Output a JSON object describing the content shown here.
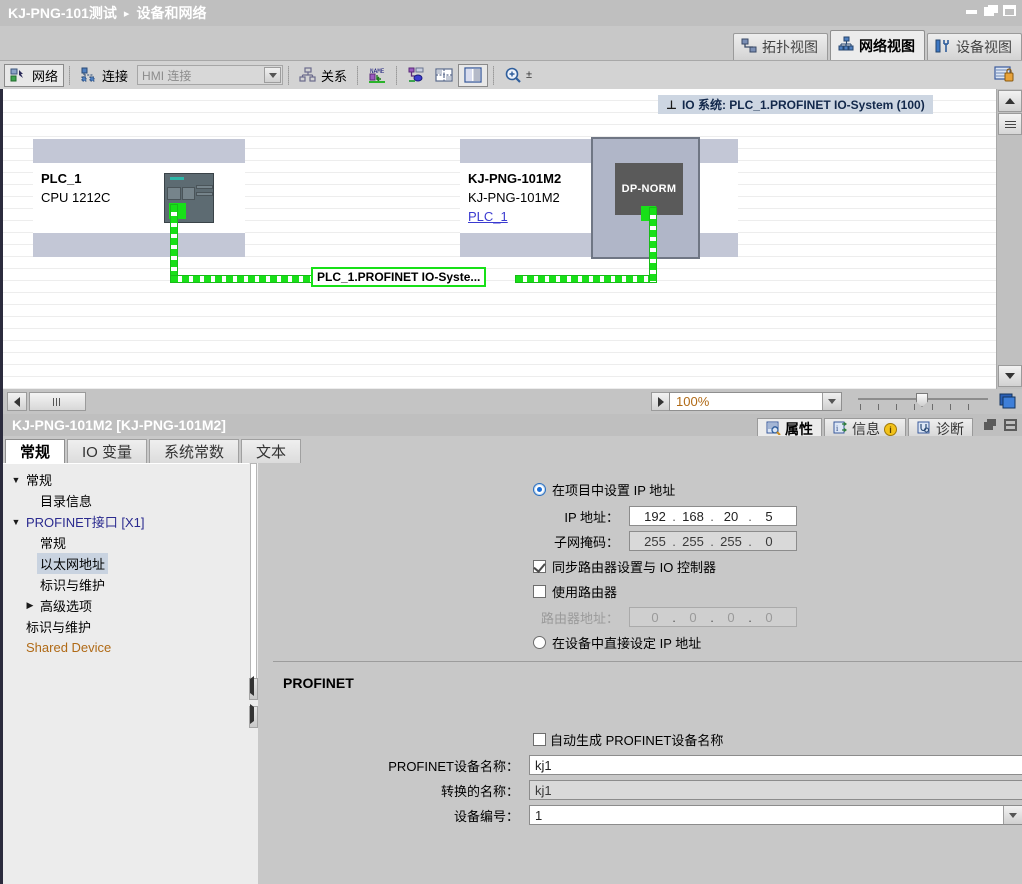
{
  "titlebar": {
    "breadcrumb": [
      "KJ-PNG-101测试",
      "设备和网络"
    ],
    "separator": "▸",
    "minimize": "minimize",
    "restore": "restore",
    "maximize": "maximize"
  },
  "view_tabs": [
    {
      "label": "拓扑视图",
      "icon": "topology-icon",
      "active": false
    },
    {
      "label": "网络视图",
      "icon": "network-icon",
      "active": true
    },
    {
      "label": "设备视图",
      "icon": "device-icon",
      "active": false
    }
  ],
  "toolbar": {
    "network_label": "网络",
    "connection_label": "连接",
    "connection_combo_value": "HMI 连接",
    "relation_label": "关系",
    "icons": [
      "name-overlay-icon",
      "address-overlay-icon",
      "page-break-icon",
      "columns-icon",
      "zoom-icon"
    ]
  },
  "canvas": {
    "io_system_badge": "IO 系统: PLC_1.PROFINET IO-System (100)",
    "io_system_pin": "⊥",
    "devices": [
      {
        "name": "PLC_1",
        "type": "CPU 1212C",
        "link": null,
        "module_label": null
      },
      {
        "name": "KJ-PNG-101M2",
        "type": "KJ-PNG-101M2",
        "link": "PLC_1",
        "module_label": "DP-NORM"
      }
    ],
    "connection_label": "PLC_1.PROFINET IO-Syste...",
    "link_color": "#18e018"
  },
  "statusbar": {
    "zoom_value": "100%",
    "scroll_left": "◀",
    "scroll_right": "▶"
  },
  "inspector": {
    "title": "KJ-PNG-101M2 [KJ-PNG-101M2]",
    "tabs": [
      {
        "label": "属性",
        "icon": "properties-icon",
        "active": true
      },
      {
        "label": "信息",
        "icon": "info-icon",
        "badge": "i",
        "active": false
      },
      {
        "label": "诊断",
        "icon": "diagnostics-icon",
        "active": false
      }
    ],
    "property_tabs": [
      {
        "label": "常规",
        "active": true
      },
      {
        "label": "IO 变量",
        "active": false
      },
      {
        "label": "系统常数",
        "active": false
      },
      {
        "label": "文本",
        "active": false
      }
    ],
    "nav_items": [
      {
        "label": "常规",
        "indent": 0,
        "tri": "▼",
        "selected": false,
        "style": "normal"
      },
      {
        "label": "目录信息",
        "indent": 1,
        "tri": "",
        "selected": false,
        "style": "normal"
      },
      {
        "label": "PROFINET接口 [X1]",
        "indent": 0,
        "tri": "▼",
        "selected": false,
        "style": "blue"
      },
      {
        "label": "常规",
        "indent": 1,
        "tri": "",
        "selected": false,
        "style": "normal"
      },
      {
        "label": "以太网地址",
        "indent": 1,
        "tri": "",
        "selected": true,
        "style": "normal"
      },
      {
        "label": "标识与维护",
        "indent": 1,
        "tri": "",
        "selected": false,
        "style": "normal"
      },
      {
        "label": "高级选项",
        "indent": 1,
        "tri": "▶",
        "selected": false,
        "style": "normal"
      },
      {
        "label": "标识与维护",
        "indent": 0,
        "tri": "",
        "selected": false,
        "style": "normal"
      },
      {
        "label": "Shared Device",
        "indent": 0,
        "tri": "",
        "selected": false,
        "style": "orange"
      }
    ],
    "ip_section": {
      "set_in_project_label": "在项目中设置 IP 地址",
      "set_in_project_selected": true,
      "ip_label": "IP 地址：",
      "ip_octets": [
        "192",
        "168",
        "20",
        "5"
      ],
      "subnet_label": "子网掩码：",
      "subnet_octets": [
        "255",
        "255",
        "255",
        "0"
      ],
      "sync_router_label": "同步路由器设置与 IO 控制器",
      "sync_router_checked": true,
      "use_router_label": "使用路由器",
      "use_router_checked": false,
      "router_addr_label": "路由器地址：",
      "router_octets": [
        "0",
        "0",
        "0",
        "0"
      ],
      "set_in_device_label": "在设备中直接设定 IP 地址",
      "set_in_device_selected": false
    },
    "profinet_section": {
      "title": "PROFINET",
      "auto_generate_label": "自动生成 PROFINET设备名称",
      "auto_generate_checked": false,
      "device_name_label": "PROFINET设备名称：",
      "device_name_value": "kj1",
      "converted_name_label": "转换的名称：",
      "converted_name_value": "kj1",
      "device_number_label": "设备编号：",
      "device_number_value": "1"
    }
  },
  "colors": {
    "accent_green": "#18e018",
    "link_blue": "#3b3bd0",
    "selection_blue": "#c9d3e0",
    "chrome": "#c8c8c8"
  }
}
